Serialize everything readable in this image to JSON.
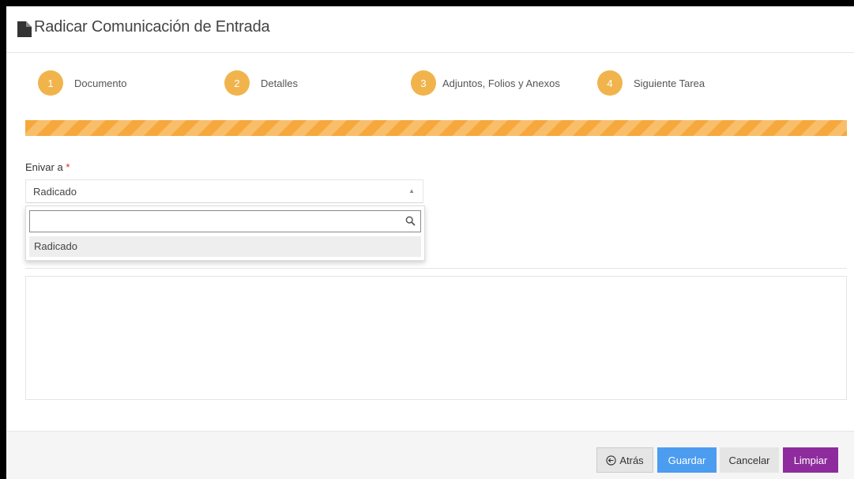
{
  "header": {
    "title": "Radicar Comunicación de Entrada",
    "icon": "file-icon"
  },
  "wizard": {
    "steps": [
      {
        "number": "1",
        "label": "Documento"
      },
      {
        "number": "2",
        "label": "Detalles"
      },
      {
        "number": "3",
        "label": "Adjuntos, Folios y Anexos"
      },
      {
        "number": "4",
        "label": "Siguiente Tarea"
      }
    ],
    "progress_percent": 100
  },
  "form": {
    "send_to": {
      "label": "Enivar a",
      "required_marker": "*",
      "selected_value": "Radicado",
      "search_placeholder": "",
      "options": [
        "Radicado"
      ]
    }
  },
  "footer": {
    "back_label": "Atrás",
    "save_label": "Guardar",
    "cancel_label": "Cancelar",
    "clear_label": "Limpiar"
  },
  "colors": {
    "step_accent": "#f1b44c",
    "progress_stripe_a": "#f6a83d",
    "progress_stripe_b": "#f8be6a",
    "save_button": "#4c9cf0",
    "clear_button": "#8e2c9e",
    "required": "#e02222"
  }
}
